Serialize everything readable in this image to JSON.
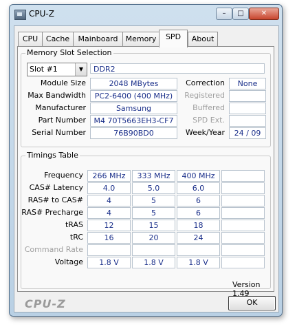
{
  "window": {
    "title": "CPU-Z",
    "controls": {
      "minimize": "–",
      "maximize": "□",
      "close": "✕"
    }
  },
  "tabs": [
    "CPU",
    "Cache",
    "Mainboard",
    "Memory",
    "SPD",
    "About"
  ],
  "active_tab": "SPD",
  "memory_slot": {
    "group_title": "Memory Slot Selection",
    "selected_slot": "Slot #1",
    "memory_type": "DDR2",
    "labels": {
      "module_size": "Module Size",
      "max_bandwidth": "Max Bandwidth",
      "manufacturer": "Manufacturer",
      "part_number": "Part Number",
      "serial_number": "Serial Number",
      "correction": "Correction",
      "registered": "Registered",
      "buffered": "Buffered",
      "spd_ext": "SPD Ext.",
      "week_year": "Week/Year"
    },
    "values": {
      "module_size": "2048 MBytes",
      "max_bandwidth": "PC2-6400 (400 MHz)",
      "manufacturer": "Samsung",
      "part_number": "M4 70T5663EH3-CF7",
      "serial_number": "76B90BD0",
      "correction": "None",
      "registered": "",
      "buffered": "",
      "spd_ext": "",
      "week_year": "24 / 09"
    }
  },
  "timings": {
    "group_title": "Timings Table",
    "rows": [
      {
        "label": "Frequency",
        "values": [
          "266 MHz",
          "333 MHz",
          "400 MHz",
          ""
        ],
        "dim": false
      },
      {
        "label": "CAS# Latency",
        "values": [
          "4.0",
          "5.0",
          "6.0",
          ""
        ],
        "dim": false
      },
      {
        "label": "RAS# to CAS#",
        "values": [
          "4",
          "5",
          "6",
          ""
        ],
        "dim": false
      },
      {
        "label": "RAS# Precharge",
        "values": [
          "4",
          "5",
          "6",
          ""
        ],
        "dim": false
      },
      {
        "label": "tRAS",
        "values": [
          "12",
          "15",
          "18",
          ""
        ],
        "dim": false
      },
      {
        "label": "tRC",
        "values": [
          "16",
          "20",
          "24",
          ""
        ],
        "dim": false
      },
      {
        "label": "Command Rate",
        "values": [
          "",
          "",
          "",
          ""
        ],
        "dim": true
      },
      {
        "label": "Voltage",
        "values": [
          "1.8 V",
          "1.8 V",
          "1.8 V",
          ""
        ],
        "dim": false
      }
    ]
  },
  "footer": {
    "version": "Version 1.49",
    "brand": "CPU-Z",
    "ok_label": "OK"
  }
}
